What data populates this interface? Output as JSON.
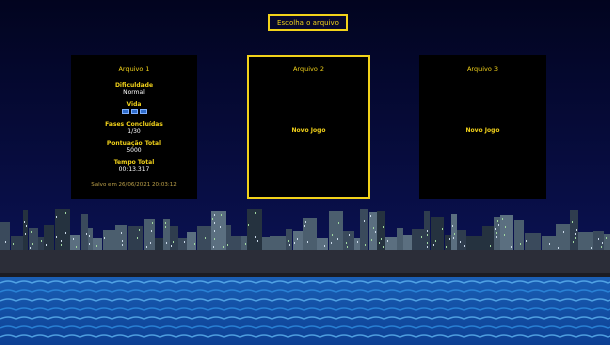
{
  "header": {
    "title": "Escolha o arquivo"
  },
  "slots": [
    {
      "title": "Arquivo 1",
      "difficulty_label": "Dificuldade",
      "difficulty_value": "Normal",
      "life_label": "Vida",
      "life_count": 3,
      "phases_label": "Fases Concluídas",
      "phases_value": "1/30",
      "score_label": "Pontuação Total",
      "score_value": "5000",
      "time_label": "Tempo Total",
      "time_value": "00:13.317",
      "saved_text": "Salvo em 26/06/2021 20:03:12"
    },
    {
      "title": "Arquivo 2",
      "new_game": "Novo Jogo",
      "selected": true
    },
    {
      "title": "Arquivo 3",
      "new_game": "Novo Jogo"
    }
  ],
  "colors": {
    "accent": "#f2d21a",
    "sky": "#03062b",
    "water": "#1b63b8"
  }
}
